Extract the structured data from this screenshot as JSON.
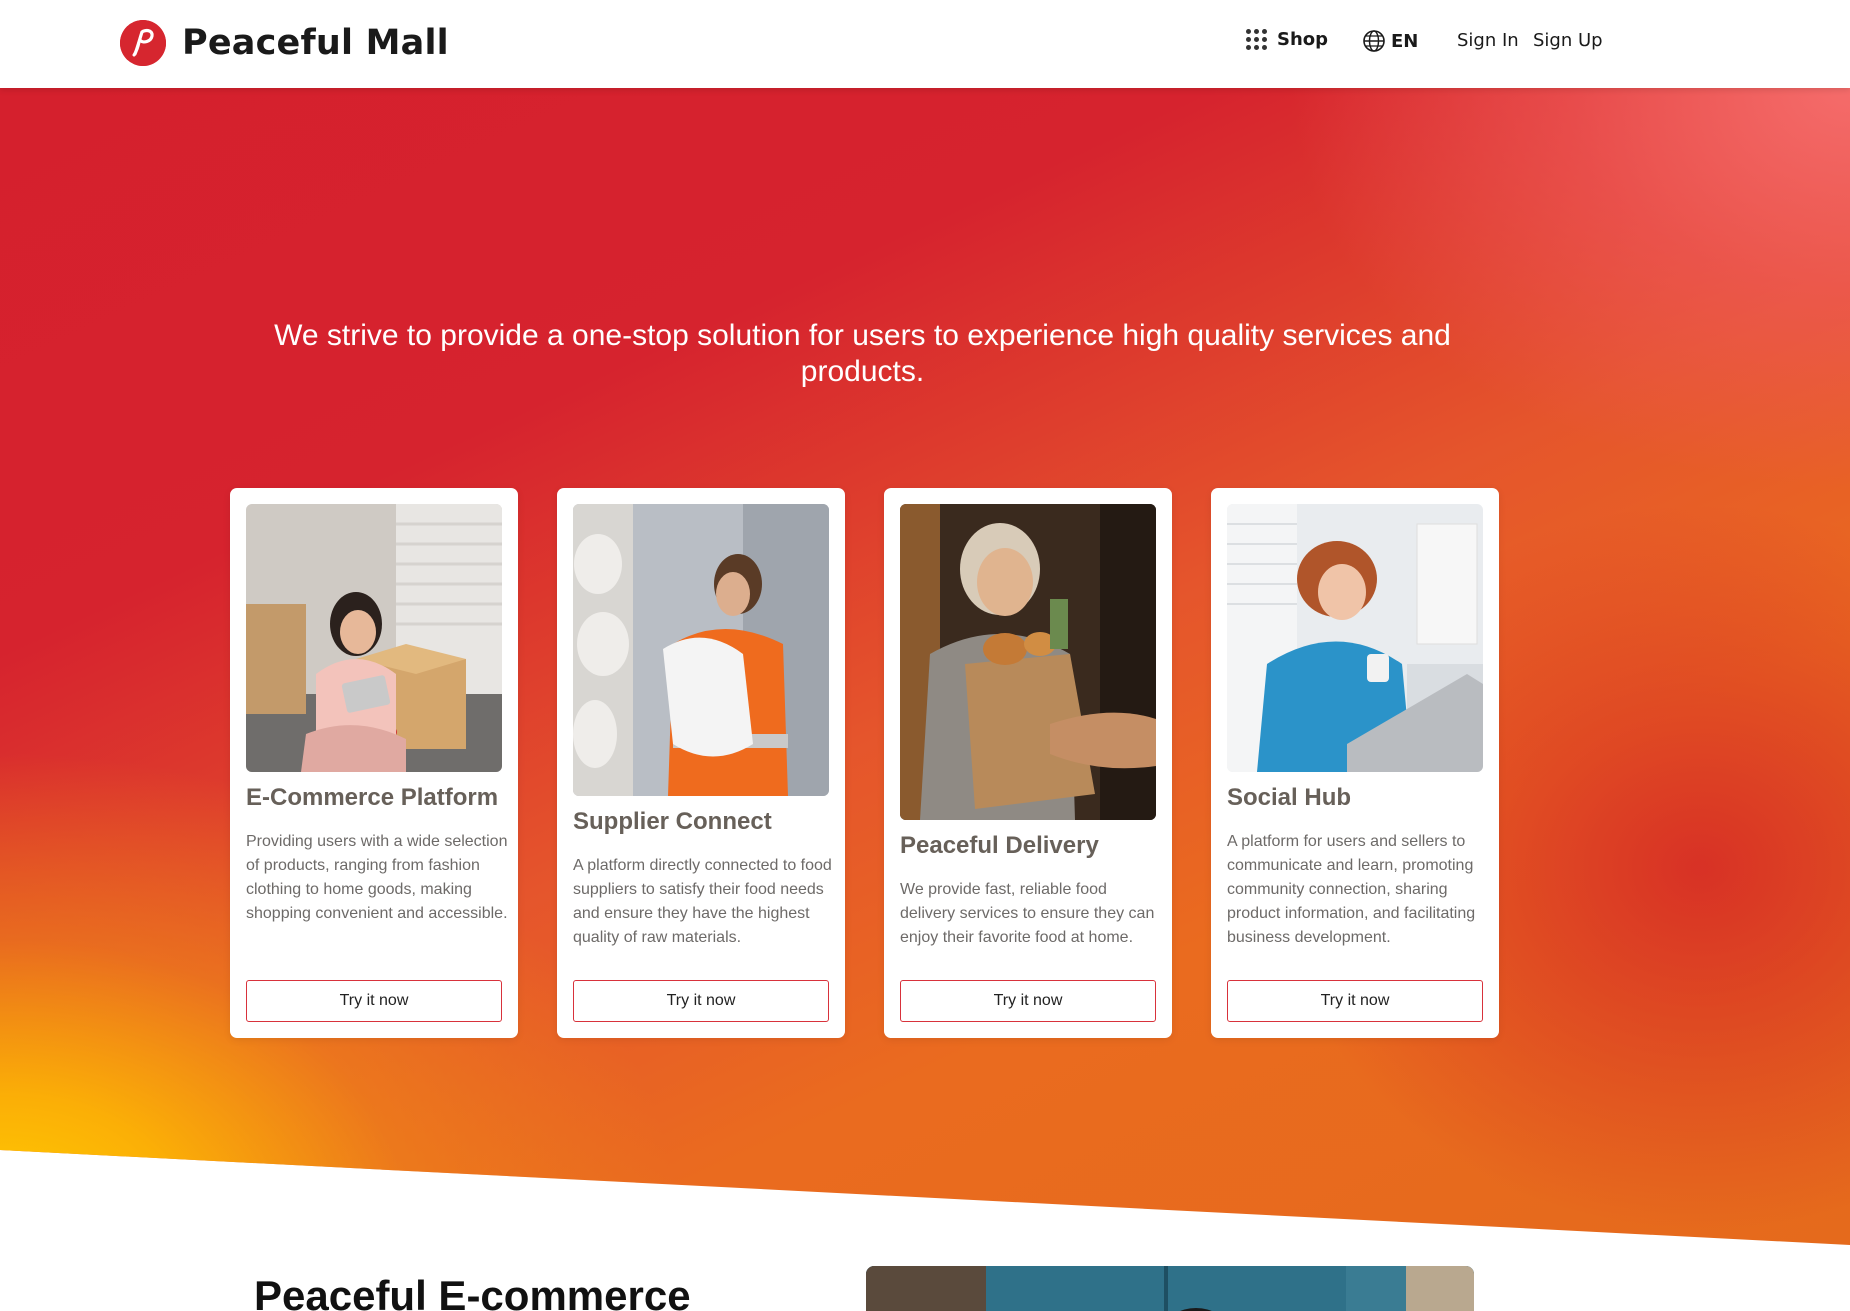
{
  "header": {
    "brand_name": "Peaceful Mall",
    "logo_letter": "P",
    "nav": {
      "shop_label": "Shop",
      "lang_label": "EN",
      "sign_in_label": "Sign In",
      "sign_up_label": "Sign Up"
    }
  },
  "hero": {
    "tagline": "We strive to provide a one-stop solution for users to experience high quality services and products."
  },
  "cards": [
    {
      "title": "E-Commerce Platform",
      "description": "Providing users with a wide selection of products, ranging from fashion clothing to home goods, making shopping convenient and accessible.",
      "button_label": "Try it now",
      "image_icon": "photo-woman-with-package"
    },
    {
      "title": "Supplier Connect",
      "description": "A platform directly connected to food suppliers to satisfy their food needs and ensure they have the highest quality of raw materials.",
      "button_label": "Try it now",
      "image_icon": "photo-warehouse-worker"
    },
    {
      "title": "Peaceful Delivery",
      "description": "We provide fast, reliable food delivery services to ensure they can enjoy their favorite food at home.",
      "button_label": "Try it now",
      "image_icon": "photo-grocery-delivery"
    },
    {
      "title": "Social Hub",
      "description": "A platform for users and sellers to communicate and learn, promoting community connection, sharing product information, and facilitating business development.",
      "button_label": "Try it now",
      "image_icon": "photo-woman-with-laptop"
    }
  ],
  "section2": {
    "title_bold": "Peaceful",
    "title_rest": " E-commerce"
  },
  "colors": {
    "brand_red": "#d6262f",
    "hero_yellow": "#ffc800",
    "button_border": "#d8323b"
  }
}
